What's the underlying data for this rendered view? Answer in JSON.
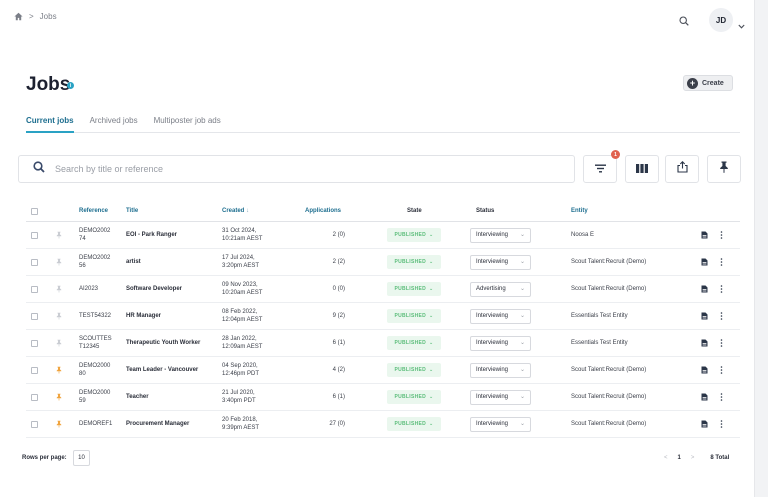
{
  "breadcrumb": {
    "home_icon": "home-icon",
    "separator": ">",
    "current": "Jobs"
  },
  "user": {
    "initials": "JD"
  },
  "page": {
    "title": "Jobs",
    "info_glyph": "i",
    "create_label": "Create"
  },
  "tabs": [
    {
      "label": "Current jobs",
      "active": true
    },
    {
      "label": "Archived jobs",
      "active": false
    },
    {
      "label": "Multiposter job ads",
      "active": false
    }
  ],
  "search": {
    "placeholder": "Search by title or reference"
  },
  "toolbar": {
    "filter_badge": "1"
  },
  "table": {
    "headers": {
      "reference": "Reference",
      "title": "Title",
      "created": "Created",
      "sort_glyph": "↓",
      "applications": "Applications",
      "state": "State",
      "status": "Status",
      "entity": "Entity"
    },
    "state_chevron": "⌄",
    "status_chevron": "⌄",
    "rows": [
      {
        "reference": "DEMO2002\n74",
        "title": "EOI - Park Ranger",
        "created": "31 Oct 2024,\n10:21am AEST",
        "applications": "2 (0)",
        "state": "PUBLISHED",
        "status": "Interviewing",
        "entity": "Noosa E",
        "pinned": false
      },
      {
        "reference": "DEMO2002\n56",
        "title": "artist",
        "created": "17 Jul 2024,\n3:20pm AEST",
        "applications": "2 (2)",
        "state": "PUBLISHED",
        "status": "Interviewing",
        "entity": "Scout Talent:Recruit (Demo)",
        "pinned": false
      },
      {
        "reference": "AI2023",
        "title": "Software Developer",
        "created": "09 Nov 2023,\n10:20am AEST",
        "applications": "0 (0)",
        "state": "PUBLISHED",
        "status": "Advertising",
        "entity": "Scout Talent:Recruit (Demo)",
        "pinned": false
      },
      {
        "reference": "TEST54322",
        "title": "HR Manager",
        "created": "08 Feb 2022,\n12:04pm AEST",
        "applications": "9 (2)",
        "state": "PUBLISHED",
        "status": "Interviewing",
        "entity": "Essentials Test Entity",
        "pinned": false
      },
      {
        "reference": "SCOUTTES\nT12345",
        "title": "Therapeutic Youth Worker",
        "created": "28 Jan 2022,\n12:09am AEST",
        "applications": "6 (1)",
        "state": "PUBLISHED",
        "status": "Interviewing",
        "entity": "Essentials Test Entity",
        "pinned": false
      },
      {
        "reference": "DEMO2000\n80",
        "title": "Team Leader - Vancouver",
        "created": "04 Sep 2020,\n12:46pm PDT",
        "applications": "4 (2)",
        "state": "PUBLISHED",
        "status": "Interviewing",
        "entity": "Scout Talent:Recruit (Demo)",
        "pinned": true
      },
      {
        "reference": "DEMO2000\n59",
        "title": "Teacher",
        "created": "21 Jul 2020,\n3:40pm PDT",
        "applications": "6 (1)",
        "state": "PUBLISHED",
        "status": "Interviewing",
        "entity": "Scout Talent:Recruit (Demo)",
        "pinned": true
      },
      {
        "reference": "DEMOREF1",
        "title": "Procurement Manager",
        "created": "20 Feb 2018,\n9:39pm AEST",
        "applications": "27 (0)",
        "state": "PUBLISHED",
        "status": "Interviewing",
        "entity": "Scout Talent:Recruit (Demo)",
        "pinned": true
      }
    ]
  },
  "footer": {
    "rows_per_page_label": "Rows per page:",
    "rows_per_page_value": "10",
    "prev_glyph": "<",
    "current_page": "1",
    "next_glyph": ">",
    "total": "8 Total"
  },
  "colors": {
    "accent": "#2aa2c4",
    "pin_active": "#f0a33c",
    "pin_inactive": "#c9ccd2",
    "published_bg": "#eaf7ee",
    "published_text": "#5bbd7a",
    "badge": "#e0624f"
  }
}
